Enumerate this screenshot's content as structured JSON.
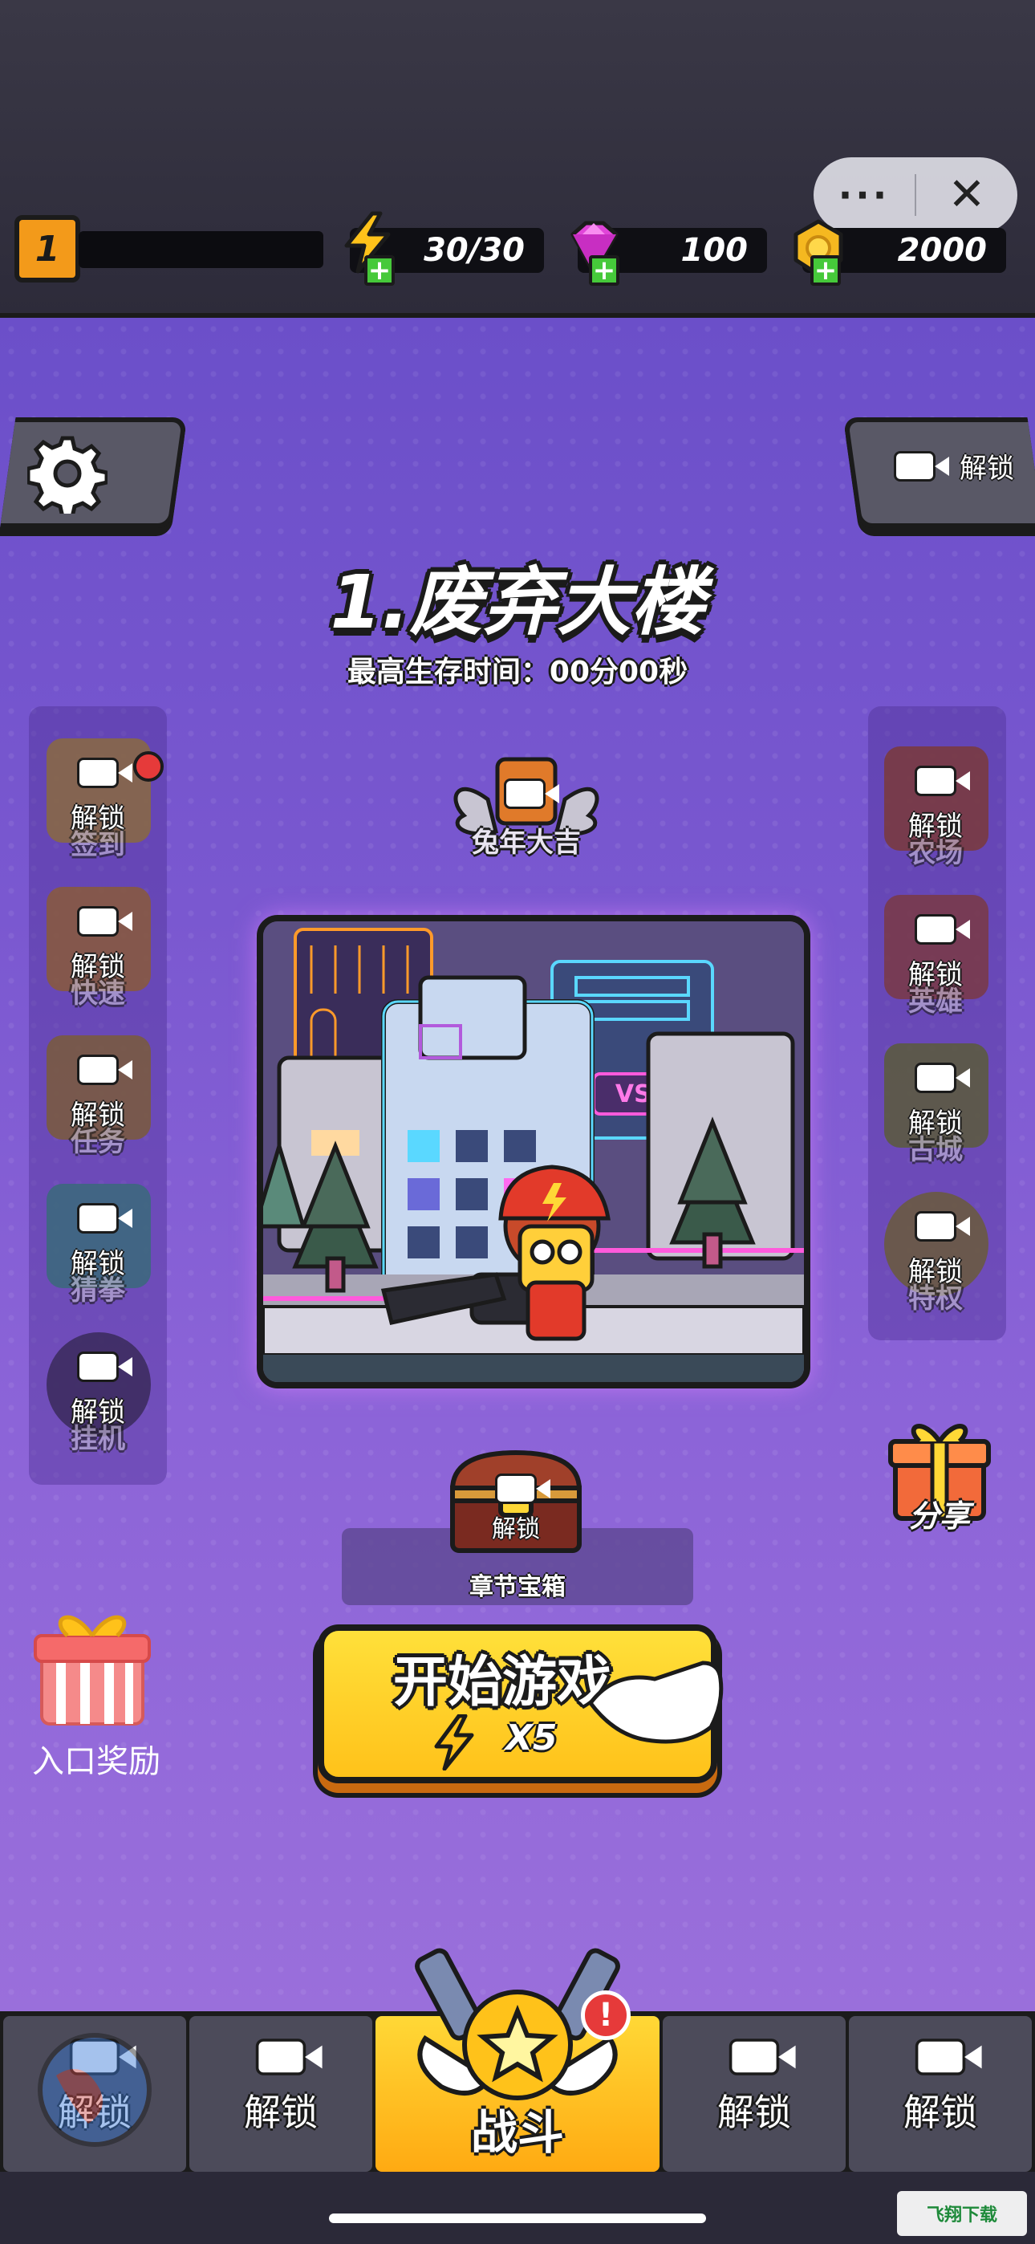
{
  "mini_program": {
    "more": "···",
    "close": "✕"
  },
  "topbar": {
    "level": "1",
    "energy": "30/30",
    "gems": "100",
    "coins": "2000"
  },
  "header": {
    "chapter_title": "1.废弃大楼",
    "best_time": "最高生存时间：00分00秒",
    "top_right_label": "解锁"
  },
  "event_badge": "兔年大吉",
  "left_menu": [
    {
      "label": "解锁",
      "sub": "签到"
    },
    {
      "label": "解锁",
      "sub": "快速"
    },
    {
      "label": "解锁",
      "sub": "任务"
    },
    {
      "label": "解锁",
      "sub": "猜拳"
    },
    {
      "label": "解锁",
      "sub": "挂机"
    }
  ],
  "right_menu": [
    {
      "label": "解锁",
      "sub": "农场"
    },
    {
      "label": "解锁",
      "sub": "英雄"
    },
    {
      "label": "解锁",
      "sub": "古城"
    },
    {
      "label": "解锁",
      "sub": "特权"
    }
  ],
  "share": "分享",
  "billboard": "VS8F",
  "chest": {
    "label": "解锁",
    "caption": "章节宝箱"
  },
  "entry_reward": "入口奖励",
  "start": {
    "label": "开始游戏",
    "cost": "X5"
  },
  "bottom_nav": [
    {
      "label": "解锁",
      "icon": "globe-icon"
    },
    {
      "label": "解锁",
      "icon": "weapon-icon"
    },
    {
      "label": "战斗",
      "icon": "star-icon"
    },
    {
      "label": "解锁",
      "icon": "shop-icon"
    },
    {
      "label": "解锁",
      "icon": "cards-icon"
    }
  ],
  "watermark": "飞翔下载",
  "colors": {
    "accent": "#ffd836",
    "bg_purple": "#7a58d0",
    "outline": "#1b1b1b"
  }
}
